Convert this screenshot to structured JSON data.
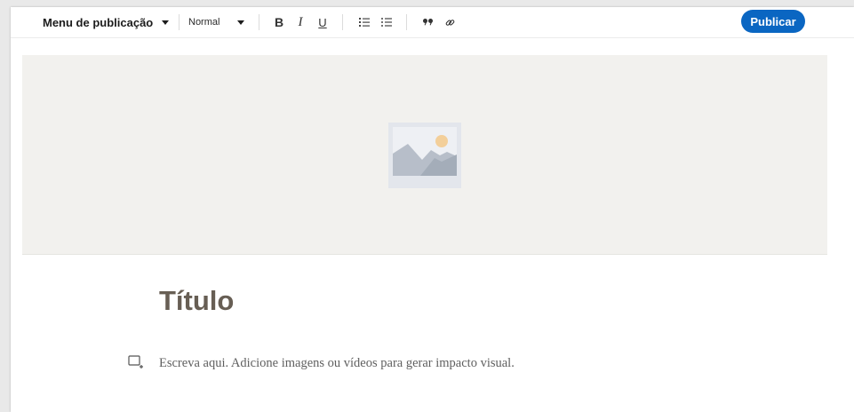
{
  "toolbar": {
    "publication_menu_label": "Menu de publicação",
    "text_style_value": "Normal",
    "bold_label": "B",
    "italic_label": "I",
    "underline_label": "U",
    "publish_label": "Publicar"
  },
  "icons": {
    "publication_menu": "caret-down-icon",
    "text_style": "caret-down-icon",
    "numbered_list": "numbered-list-icon",
    "bulleted_list": "bulleted-list-icon",
    "quote": "quote-icon",
    "link": "link-icon",
    "cover": "image-placeholder-icon",
    "add_media": "add-media-icon"
  },
  "editor": {
    "title_placeholder": "Título",
    "body_placeholder": "Escreva aqui. Adicione imagens ou vídeos para gerar impacto visual."
  },
  "colors": {
    "accent": "#0a66c2",
    "cover_background": "#f2f1ee",
    "title_text": "#675e54"
  }
}
